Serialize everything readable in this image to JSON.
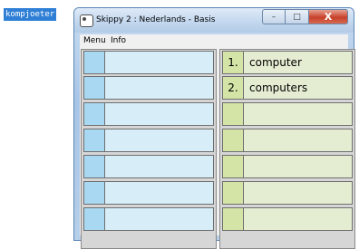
{
  "selected_word": "kompjoeter",
  "window": {
    "title": "Skippy 2 : Nederlands - Basis",
    "controls": {
      "minimize": "–",
      "maximize": "□",
      "close": "X"
    }
  },
  "menu": [
    "Menu",
    "Info"
  ],
  "left_panel": {
    "rows": [
      "",
      "",
      "",
      "",
      "",
      "",
      ""
    ]
  },
  "right_panel": {
    "rows": [
      {
        "num": "1.",
        "word": "computer"
      },
      {
        "num": "2.",
        "word": "computers"
      },
      {
        "num": "",
        "word": ""
      },
      {
        "num": "",
        "word": ""
      },
      {
        "num": "",
        "word": ""
      },
      {
        "num": "",
        "word": ""
      },
      {
        "num": "",
        "word": ""
      }
    ]
  }
}
